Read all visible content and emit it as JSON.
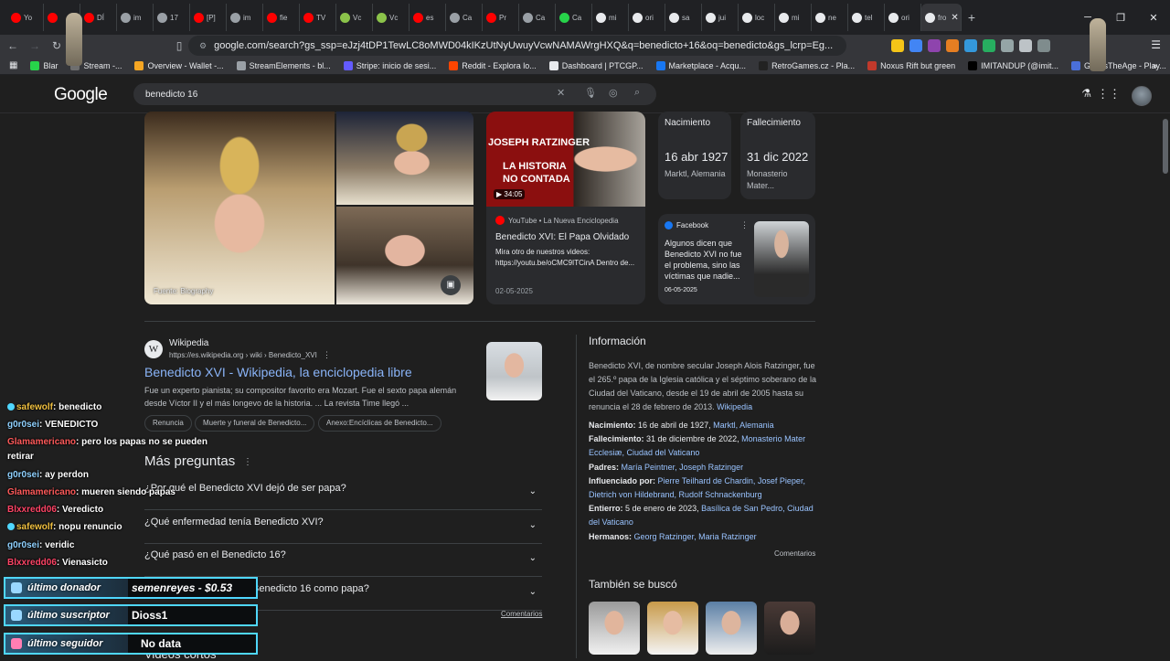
{
  "tabs": [
    {
      "label": "Yo",
      "color": "#ff0000"
    },
    {
      "label": "",
      "color": "#ff0000"
    },
    {
      "label": "DÍ",
      "color": "#ff0000"
    },
    {
      "label": "im",
      "color": "#9aa0a6"
    },
    {
      "label": "17",
      "color": "#9aa0a6"
    },
    {
      "label": "[P]",
      "color": "#ff0000"
    },
    {
      "label": "im",
      "color": "#9aa0a6"
    },
    {
      "label": "fie",
      "color": "#ff0000"
    },
    {
      "label": "TV",
      "color": "#ff0000"
    },
    {
      "label": "Vc",
      "color": "#8bc34a"
    },
    {
      "label": "Vc",
      "color": "#8bc34a"
    },
    {
      "label": "es",
      "color": "#ff0000"
    },
    {
      "label": "Ca",
      "color": "#9aa0a6"
    },
    {
      "label": "Pr",
      "color": "#ff0000"
    },
    {
      "label": "Ca",
      "color": "#9aa0a6"
    },
    {
      "label": "Ca",
      "color": "#27d34a"
    },
    {
      "label": "mi",
      "color": "#e8eaed"
    },
    {
      "label": "ori",
      "color": "#e8eaed"
    },
    {
      "label": "sa",
      "color": "#e8eaed"
    },
    {
      "label": "jui",
      "color": "#e8eaed"
    },
    {
      "label": "loc",
      "color": "#e8eaed"
    },
    {
      "label": "mi",
      "color": "#e8eaed"
    },
    {
      "label": "ne",
      "color": "#e8eaed"
    },
    {
      "label": "tel",
      "color": "#e8eaed"
    },
    {
      "label": "ori",
      "color": "#e8eaed"
    },
    {
      "label": "fro",
      "color": "#e8eaed"
    }
  ],
  "url": "google.com/search?gs_ssp=eJzj4tDP1TewLC8oMWD04kIKzUtNyUwuyVcwNAMAWrgHXQ&q=benedicto+16&oq=benedicto&gs_lcrp=Eg...",
  "bookmarks": [
    {
      "label": "Blar",
      "color": "#27d34a"
    },
    {
      "label": "Stream -...",
      "color": "#6e6e6e"
    },
    {
      "label": "Overview - Wallet -...",
      "color": "#f5a623"
    },
    {
      "label": "StreamElements - bl...",
      "color": "#9aa0a6"
    },
    {
      "label": "Stripe: inicio de sesi...",
      "color": "#635bff"
    },
    {
      "label": "Reddit - Explora lo...",
      "color": "#ff4500"
    },
    {
      "label": "Dashboard | PTCGP...",
      "color": "#e8eaed"
    },
    {
      "label": "Marketplace - Acqu...",
      "color": "#1877f2"
    },
    {
      "label": "RetroGames.cz - Pla...",
      "color": "#222222"
    },
    {
      "label": "Noxus Rift but green",
      "color": "#c0392b"
    },
    {
      "label": "IMITANDUP (@imit...",
      "color": "#000000"
    },
    {
      "label": "GuessTheAge - Play...",
      "color": "#4a6fd8"
    }
  ],
  "google": {
    "logo": "Google",
    "query": "benedicto 16"
  },
  "images": {
    "source_caption": "Fuente: Biography"
  },
  "youtube": {
    "thumb_title_1": "JOSEPH RATZINGER",
    "thumb_title_2": "LA HISTORIA",
    "thumb_title_3": "NO CONTADA",
    "duration": "▶ 34:05",
    "source": "YouTube • La Nueva Enciclopedia",
    "title": "Benedicto XVI: El Papa Olvidado",
    "snippet": "Mira otro de nuestros videos: https://youtu.be/oCMC9ITCinA Dentro de...",
    "date": "02-05-2025"
  },
  "birth_card": {
    "label": "Nacimiento",
    "date": "16 abr 1927",
    "place": "Marktl, Alemania"
  },
  "death_card": {
    "label": "Fallecimiento",
    "date": "31 dic 2022",
    "place": "Monasterio Mater..."
  },
  "facebook": {
    "source": "Facebook",
    "snippet": "Algunos dicen que Benedicto XVI no fue el problema, sino las víctimas que nadie...",
    "date": "06-05-2025"
  },
  "wiki": {
    "site": "Wikipedia",
    "url": "https://es.wikipedia.org › wiki › Benedicto_XVI",
    "title": "Benedicto XVI - Wikipedia, la enciclopedia libre",
    "snippet": "Fue un experto pianista; su compositor favorito era Mozart. Fue el sexto papa alemán desde Víctor II y el más longevo de la historia. ... La revista Time llegó ...",
    "chips": [
      "Renuncia",
      "Muerte y funeral de Benedicto...",
      "Anexo:Encíclicas de Benedicto..."
    ]
  },
  "paa": {
    "title": "Más preguntas",
    "questions": [
      "¿Por qué el Benedicto XVI dejó de ser papa?",
      "¿Qué enfermedad tenía Benedicto XVI?",
      "¿Qué pasó en el Benedicto 16?",
      "¿Cuánto tiempo duró el Benedicto 16 como papa?"
    ],
    "feedback": "Comentarios"
  },
  "videos_heading": "Videos cortos",
  "info": {
    "heading": "Información",
    "description": "Benedicto XVI, de nombre secular Joseph Alois Ratzinger, fue el 265.º papa de la Iglesia católica y el séptimo soberano de la Ciudad del Vaticano, desde el 19 de abril de 2005 hasta su renuncia el 28 de febrero de 2013.",
    "description_link": "Wikipedia",
    "rows": [
      {
        "label": "Nacimiento:",
        "text": "16 de abril de 1927,",
        "links": "Marktl, Alemania"
      },
      {
        "label": "Fallecimiento:",
        "text": "31 de diciembre de 2022,",
        "links": "Monasterio Mater Ecclesiæ, Ciudad del Vaticano"
      },
      {
        "label": "Padres:",
        "text": "",
        "links": "María Peintner, Joseph Ratzinger"
      },
      {
        "label": "Influenciado por:",
        "text": "",
        "links": "Pierre Teilhard de Chardin, Josef Pieper, Dietrich von Hildebrand, Rudolf Schnackenburg"
      },
      {
        "label": "Entierro:",
        "text": "5 de enero de 2023,",
        "links": "Basílica de San Pedro, Ciudad del Vaticano"
      },
      {
        "label": "Hermanos:",
        "text": "",
        "links": "Georg Ratzinger, Maria Ratzinger"
      }
    ],
    "feedback": "Comentarios",
    "also_searched": "También se buscó"
  },
  "chat": [
    {
      "user": "safewolf",
      "msg": ": benedicto",
      "cls": "u1"
    },
    {
      "user": "g0r0sei",
      "msg": ": VENEDICTO",
      "cls": "u2"
    },
    {
      "user": "Glamamericano",
      "msg": ": pero los papas no se pueden",
      "cls": "u3"
    },
    {
      "user": "",
      "msg": "retirar",
      "cls": "u3"
    },
    {
      "user": "g0r0sei",
      "msg": ": ay perdon",
      "cls": "u2"
    },
    {
      "user": "Glamamericano",
      "msg": ": mueren siendo papas",
      "cls": "u3"
    },
    {
      "user": "Blxxredd06",
      "msg": ": Veredicto",
      "cls": "u4"
    },
    {
      "user": "safewolf",
      "msg": ": nopu renuncio",
      "cls": "u1"
    },
    {
      "user": "g0r0sei",
      "msg": ": veridic",
      "cls": "u2"
    },
    {
      "user": "Blxxredd06",
      "msg": ": Vienasicto",
      "cls": "u4"
    }
  ],
  "alerts": {
    "donor_label": "último donador",
    "donor_value": "semenreyes - $0.53",
    "sub_label": "último suscriptor",
    "sub_value": "Dioss1",
    "follow_label": "último seguidor",
    "follow_value": "No data"
  }
}
